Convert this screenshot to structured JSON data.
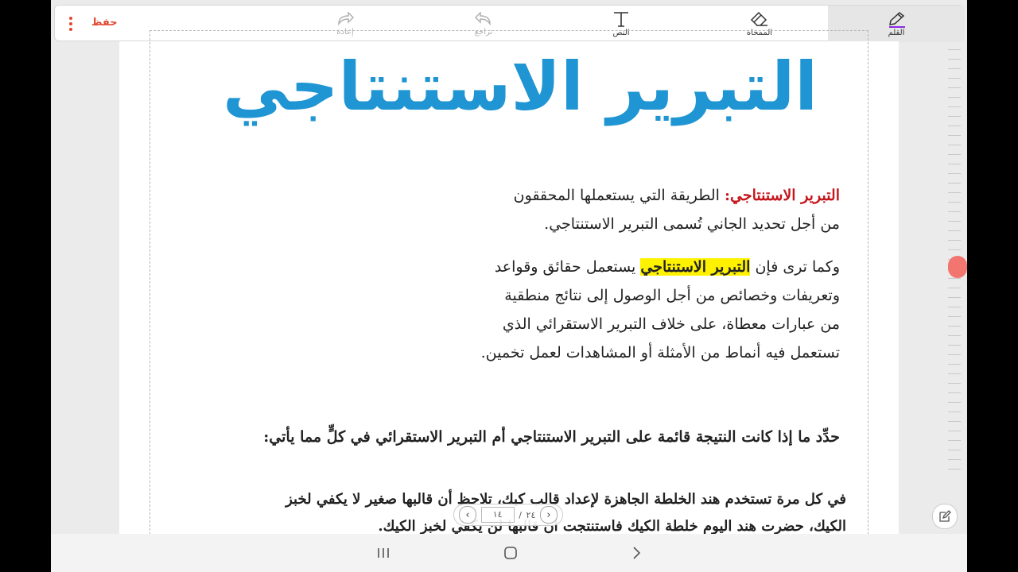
{
  "toolbar": {
    "save_label": "حفظ",
    "redo_label": "إعادة",
    "undo_label": "تراجع",
    "text_label": "النص",
    "eraser_label": "الممحاة",
    "pen_label": "القلم"
  },
  "document": {
    "title": "التبرير الاستنتاجي",
    "definition_term": "التبرير الاستنتاجي:",
    "definition_text_1": "الطريقة التي يستعملها المحققون",
    "definition_text_2": "من أجل تحديد الجاني تُسمى التبرير الاستنتاجي.",
    "para2_before": "وكما ترى فإن",
    "para2_highlight": "التبرير الاستنتاجي",
    "para2_after": "يستعمل حقائق وقواعد",
    "para2_line2": "وتعريفات وخصائص من أجل الوصول إلى نتائج منطقية",
    "para2_line3": "من عبارات معطاة، على خلاف التبرير الاستقرائي الذي",
    "para2_line4": "تستعمل فيه أنماط من الأمثلة أو المشاهدات لعمل تخمين.",
    "question": "حدِّد ما إذا كانت النتيجة قائمة على التبرير الاستنتاجي أم التبرير الاستقرائي في كلٍّ مما يأتي:",
    "example_line1": "في كل مرة تستخدم هند الخلطة الجاهزة لإعداد قالب كيك، تلاحظ أن قالبها صغير لا يكفي لخبز",
    "example_line2": "الكيك، حضرت هند اليوم خلطة الكيك فاستنتجت أن قالبها لن يكفي لخبز الكيك."
  },
  "pager": {
    "current_page": "١٤",
    "separator": "/",
    "total_pages": "٢٤"
  }
}
